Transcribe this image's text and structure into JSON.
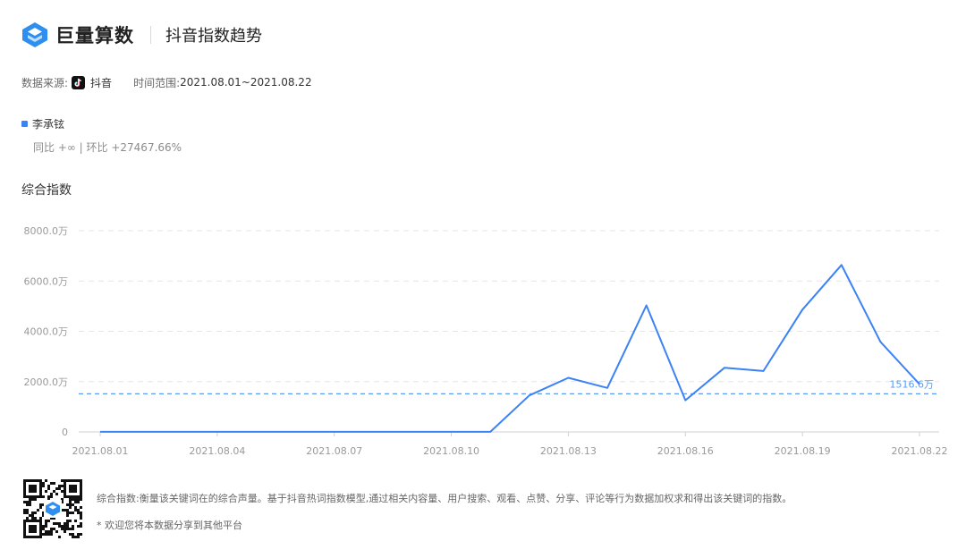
{
  "header": {
    "brand": "巨量算数",
    "title": "抖音指数趋势"
  },
  "meta": {
    "source_label": "数据来源:",
    "platform": "抖音",
    "range_label": "时间范围:",
    "range_value": "2021.08.01~2021.08.22"
  },
  "legend": {
    "name": "李承铉",
    "comparison": "同比 +∞ | 环比 +27467.66%"
  },
  "section_title": "综合指数",
  "colors": {
    "series": "#3b82f6",
    "avg_line": "#5b9bef",
    "grid": "#e6e6e6"
  },
  "chart_data": {
    "type": "line",
    "y_unit": "万",
    "ylim": [
      0,
      8000
    ],
    "y_ticks": [
      "0",
      "2000.0万",
      "4000.0万",
      "6000.0万",
      "8000.0万"
    ],
    "y_tick_values": [
      0,
      2000,
      4000,
      6000,
      8000
    ],
    "x": [
      "2021.08.01",
      "2021.08.02",
      "2021.08.03",
      "2021.08.04",
      "2021.08.05",
      "2021.08.06",
      "2021.08.07",
      "2021.08.08",
      "2021.08.09",
      "2021.08.10",
      "2021.08.11",
      "2021.08.12",
      "2021.08.13",
      "2021.08.14",
      "2021.08.15",
      "2021.08.16",
      "2021.08.17",
      "2021.08.18",
      "2021.08.19",
      "2021.08.20",
      "2021.08.21",
      "2021.08.22"
    ],
    "x_tick_labels": [
      "2021.08.01",
      "2021.08.04",
      "2021.08.07",
      "2021.08.10",
      "2021.08.13",
      "2021.08.16",
      "2021.08.19",
      "2021.08.22"
    ],
    "series": [
      {
        "values": [
          5,
          5,
          5,
          5,
          5,
          5,
          5,
          5,
          5,
          5,
          5,
          1450,
          2150,
          1750,
          5030,
          1260,
          2550,
          2420,
          4860,
          6640,
          3580,
          1900
        ]
      }
    ],
    "average": {
      "value": 1516.6,
      "label": "1516.6万"
    },
    "grid": true
  },
  "footer": {
    "description": "综合指数:衡量该关键词在的综合声量。基于抖音热词指数模型,通过相关内容量、用户搜索、观看、点赞、分享、评论等行为数据加权求和得出该关键词的指数。",
    "note": "* 欢迎您将本数据分享到其他平台"
  }
}
